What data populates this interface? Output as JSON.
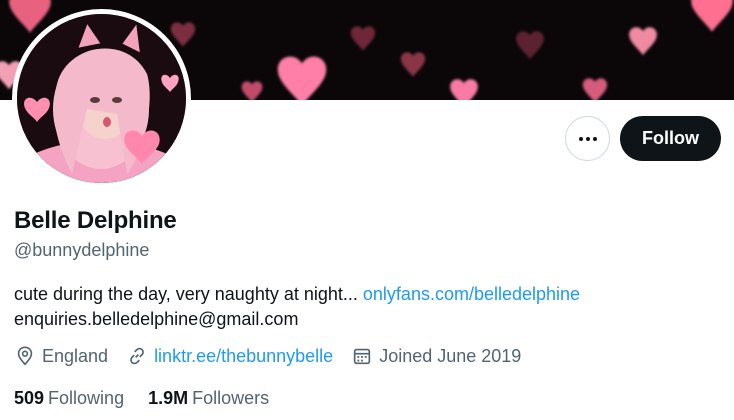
{
  "profile": {
    "display_name": "Belle Delphine",
    "handle": "@bunnydelphine",
    "bio_text": "cute during the day, very naughty at night...",
    "bio_link": "onlyfans.com/belledelphine",
    "bio_line2": "enquiries.belledelphine@gmail.com",
    "location": "England",
    "website": "linktr.ee/thebunnybelle",
    "joined": "Joined June 2019"
  },
  "stats": {
    "following_count": "509",
    "following_label": "Following",
    "followers_count": "1.9M",
    "followers_label": "Followers"
  },
  "actions": {
    "follow_label": "Follow",
    "more_icon": "more-horizontal-icon"
  },
  "icons": {
    "location": "location-pin-icon",
    "website": "link-icon",
    "joined": "calendar-icon"
  },
  "colors": {
    "accent": "#1d9bf0",
    "text_primary": "#0f1419",
    "text_secondary": "#536471",
    "button_dark": "#0f1419",
    "banner_bg": "#0b0709",
    "heart_pink": "#ff7fa8"
  }
}
